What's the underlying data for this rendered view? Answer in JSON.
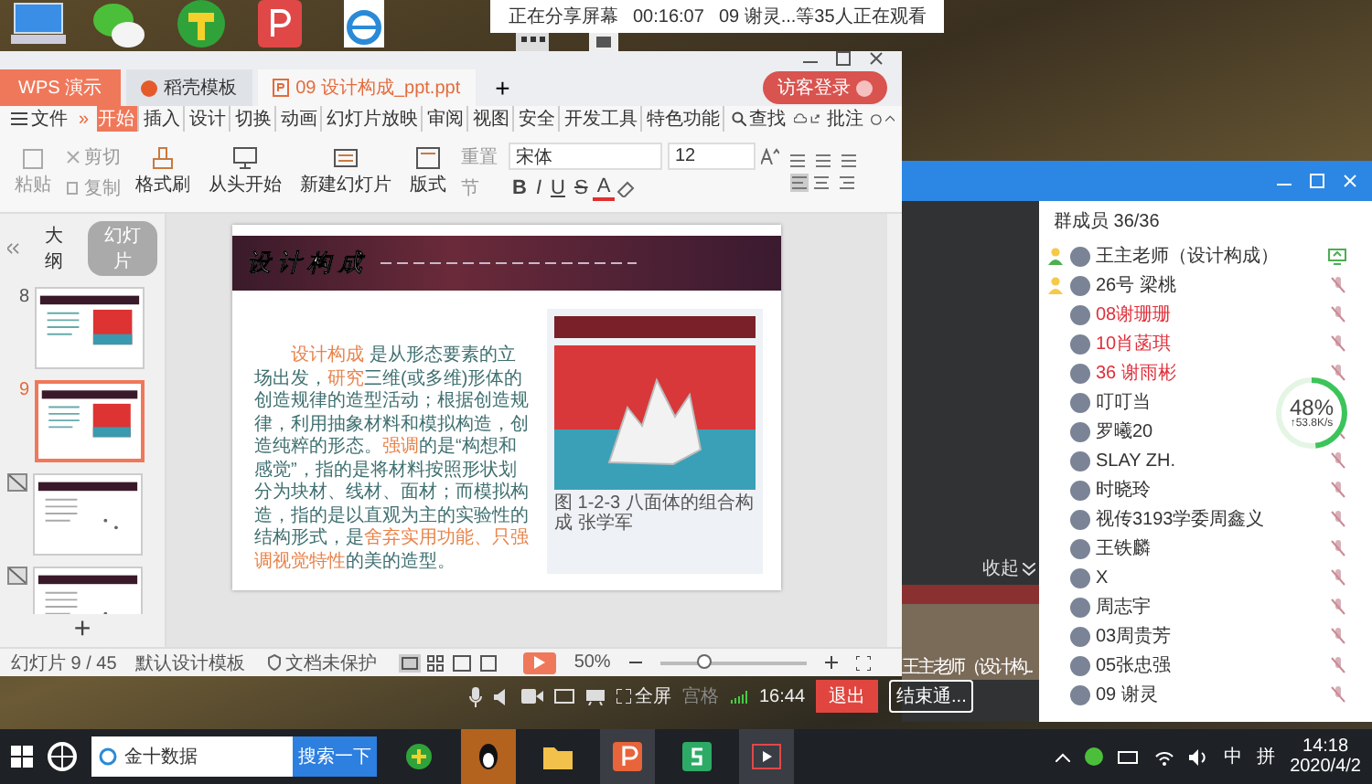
{
  "share_bar": {
    "status": "正在分享屏幕",
    "timer": "00:16:07",
    "viewers": "09 谢灵...等35人正在观看"
  },
  "wps": {
    "tabs": [
      {
        "label": "WPS 演示",
        "kind": "app",
        "selected": false
      },
      {
        "label": "稻壳模板",
        "kind": "template",
        "selected": false
      },
      {
        "label": "09 设计构成_ppt.ppt",
        "kind": "document",
        "selected": true
      }
    ],
    "new_tab": "+",
    "login_button": "访客登录",
    "file_menu": "文件",
    "more": "»",
    "ribbon_tabs": [
      {
        "label": "开始",
        "selected": true
      },
      {
        "label": "插入",
        "selected": false
      },
      {
        "label": "设计",
        "selected": false
      },
      {
        "label": "切换",
        "selected": false
      },
      {
        "label": "动画",
        "selected": false
      },
      {
        "label": "幻灯片放映",
        "selected": false
      },
      {
        "label": "审阅",
        "selected": false
      },
      {
        "label": "视图",
        "selected": false
      },
      {
        "label": "安全",
        "selected": false
      },
      {
        "label": "开发工具",
        "selected": false
      },
      {
        "label": "特色功能",
        "selected": false
      }
    ],
    "search": "查找",
    "comment": "批注",
    "toolbar": {
      "paste": "粘贴",
      "cut": "剪切",
      "copy": "复制",
      "format_painter": "格式刷",
      "play_from_start": "从头开始",
      "new_slide": "新建幻灯片",
      "layout": "版式",
      "reset": "重置",
      "section": "节",
      "font": "宋体",
      "font_size": "12",
      "format_buttons": [
        "B",
        "I",
        "U",
        "S",
        "A"
      ]
    },
    "panel_tabs": [
      {
        "label": "大纲",
        "selected": false
      },
      {
        "label": "幻灯片",
        "selected": true
      }
    ],
    "slides": [
      {
        "number": "8",
        "selected": false,
        "hidden": false
      },
      {
        "number": "9",
        "selected": true,
        "hidden": false
      },
      {
        "selected": false,
        "hidden": true
      },
      {
        "selected": false,
        "hidden": true
      }
    ],
    "add_slide": "+",
    "slide": {
      "banner_title": "设 计 构 成",
      "body": [
        {
          "text": "设计构成",
          "highlight": true
        },
        {
          "text": " 是从形态要素的立场出发，",
          "highlight": false
        },
        {
          "text": "研究",
          "highlight": true
        },
        {
          "text": "三维(或多维)形体的创造规律的造型活动；根据创造规律，利用抽象材料和模拟构造，创造纯粹的形态。",
          "highlight": false
        },
        {
          "text": "强调",
          "highlight": true
        },
        {
          "text": "的是“构想和感觉”，指的是将材料按照形状划分为块材、线材、面材；而模拟构造，指的是以直观为主的实验性的结构形式，是",
          "highlight": false
        },
        {
          "text": "舍弃实用功能、只强调视觉特性",
          "highlight": true
        },
        {
          "text": "的美的造型。",
          "highlight": false
        }
      ],
      "caption": "图 1-2-3 八面体的组合构成 张学军"
    },
    "status_bar": {
      "slide_count": "幻灯片 9 / 45",
      "template": "默认设计模板",
      "protection": "文档未保护",
      "zoom": "50%",
      "zoom_slider": {
        "level": 0.3
      }
    }
  },
  "meeting": {
    "toolbar": {
      "fullscreen": "全屏",
      "grid": "宫格",
      "clock": "16:44",
      "exit": "退出",
      "end": "结束通..."
    },
    "collapse": "收起",
    "video_caption": "王主老师（设计构...",
    "members_title": "群成员 36/36",
    "members": [
      {
        "name": "王主老师（设计构成）",
        "kind": "host",
        "sharing": true,
        "color": "#333333"
      },
      {
        "name": "26号 梁桃",
        "kind": "admin",
        "sharing": false,
        "color": "#333333"
      },
      {
        "name": "08谢珊珊",
        "kind": "member",
        "sharing": false,
        "color": "#e0303a"
      },
      {
        "name": "10肖菡琪",
        "kind": "member",
        "sharing": false,
        "color": "#e0303a"
      },
      {
        "name": "36 谢雨彬",
        "kind": "member",
        "sharing": false,
        "color": "#e0303a"
      },
      {
        "name": "叮叮当",
        "kind": "member",
        "sharing": false,
        "color": "#333333"
      },
      {
        "name": "罗曦20",
        "kind": "member",
        "sharing": false,
        "color": "#333333"
      },
      {
        "name": "SLAY ZH.",
        "kind": "member",
        "sharing": false,
        "color": "#333333"
      },
      {
        "name": "时晓玲",
        "kind": "member",
        "sharing": false,
        "color": "#333333"
      },
      {
        "name": "视传3193学委周鑫义",
        "kind": "member",
        "sharing": false,
        "color": "#333333"
      },
      {
        "name": "王铁麟",
        "kind": "member",
        "sharing": false,
        "color": "#333333"
      },
      {
        "name": "X",
        "kind": "member",
        "sharing": false,
        "color": "#333333"
      },
      {
        "name": "周志宇",
        "kind": "member",
        "sharing": false,
        "color": "#333333"
      },
      {
        "name": "03周贵芳",
        "kind": "member",
        "sharing": false,
        "color": "#333333"
      },
      {
        "name": "05张忠强",
        "kind": "member",
        "sharing": false,
        "color": "#333333"
      },
      {
        "name": "09 谢灵",
        "kind": "member",
        "sharing": false,
        "color": "#333333"
      }
    ],
    "network": {
      "percent": "48%",
      "speed": "↑53.8K/s",
      "level": 0.48
    }
  },
  "taskbar": {
    "search_value": "金十数据",
    "search_button": "搜索一下",
    "ime": "中",
    "ime_mode": "拼",
    "time": "14:18",
    "date": "2020/4/2"
  }
}
